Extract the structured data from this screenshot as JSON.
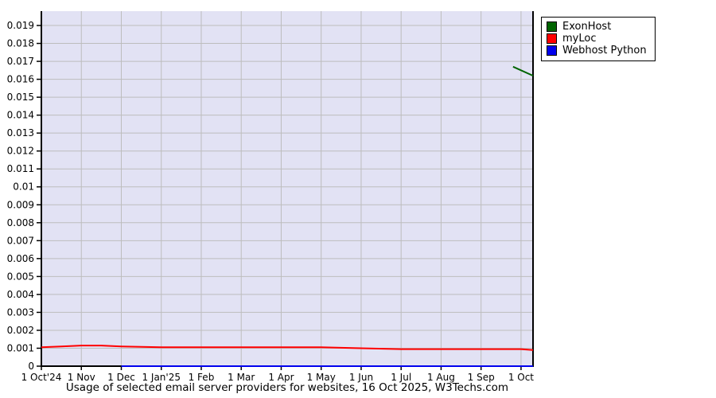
{
  "chart_data": {
    "type": "line",
    "title": "Usage of selected email server providers for websites, 16 Oct 2025, W3Techs.com",
    "xlabel": "",
    "ylabel": "",
    "x_range": [
      0,
      12.3
    ],
    "y_range": [
      0,
      0.0198
    ],
    "grid": true,
    "plot_bg": "#e2e2f4",
    "grid_color": "#bdbdbd",
    "axis_color": "#000000",
    "legend_position": "top-right-outside",
    "x_tick_positions": [
      0,
      1,
      2,
      3,
      4,
      5,
      6,
      7,
      8,
      9,
      10,
      11,
      12
    ],
    "x_tick_labels": [
      "1 Oct'24",
      "1 Nov",
      "1 Dec",
      "1 Jan'25",
      "1 Feb",
      "1 Mar",
      "1 Apr",
      "1 May",
      "1 Jun",
      "1 Jul",
      "1 Aug",
      "1 Sep",
      "1 Oct"
    ],
    "y_tick_step": 0.001,
    "y_tick_labels": [
      "0",
      "0.001",
      "0.002",
      "0.003",
      "0.004",
      "0.005",
      "0.006",
      "0.007",
      "0.008",
      "0.009",
      "0.01",
      "0.011",
      "0.012",
      "0.013",
      "0.014",
      "0.015",
      "0.016",
      "0.017",
      "0.018",
      "0.019"
    ],
    "series": [
      {
        "name": "ExonHost",
        "color": "#006400",
        "points": [
          [
            11.8,
            0.0167
          ],
          [
            12.3,
            0.0162
          ]
        ]
      },
      {
        "name": "myLoc",
        "color": "#ff0000",
        "points": [
          [
            0,
            0.00105
          ],
          [
            0.5,
            0.0011
          ],
          [
            1,
            0.00115
          ],
          [
            1.5,
            0.00115
          ],
          [
            2,
            0.0011
          ],
          [
            3,
            0.00105
          ],
          [
            4,
            0.00105
          ],
          [
            5,
            0.00105
          ],
          [
            6,
            0.00105
          ],
          [
            7,
            0.00105
          ],
          [
            8,
            0.001
          ],
          [
            9,
            0.00095
          ],
          [
            10,
            0.00095
          ],
          [
            11,
            0.00095
          ],
          [
            12,
            0.00095
          ],
          [
            12.3,
            0.0009
          ]
        ]
      },
      {
        "name": "Webhost Python",
        "color": "#0000ee",
        "points": [
          [
            2,
            0
          ],
          [
            3,
            0
          ],
          [
            4,
            0
          ],
          [
            5,
            0
          ],
          [
            6,
            0
          ],
          [
            7,
            0
          ],
          [
            8,
            0
          ],
          [
            9,
            0
          ],
          [
            10,
            0
          ],
          [
            11,
            0
          ],
          [
            12,
            0
          ],
          [
            12.3,
            0
          ]
        ]
      }
    ]
  }
}
